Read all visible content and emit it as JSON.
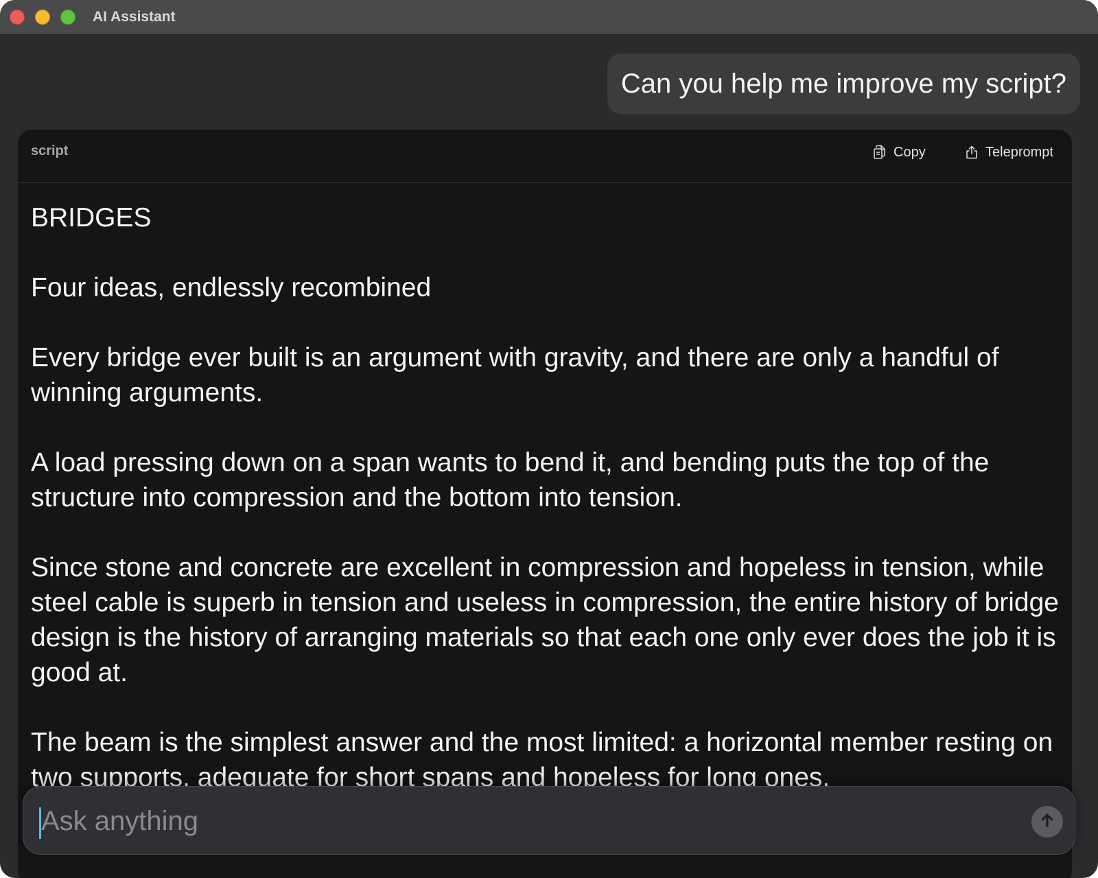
{
  "window": {
    "title": "AI Assistant"
  },
  "conversation": {
    "user_message": "Can you help me improve my script?"
  },
  "script_card": {
    "label": "script",
    "copy_label": "Copy",
    "teleprompt_label": "Teleprompt",
    "paragraphs": [
      "BRIDGES",
      "Four ideas, endlessly recombined",
      "Every bridge ever built is an argument with gravity, and there are only a handful of winning arguments.",
      "A load pressing down on a span wants to bend it, and bending puts the top of the structure into compression and the bottom into tension.",
      "Since stone and concrete are excellent in compression and hopeless in tension, while steel cable is superb in tension and useless in compression, the entire history of bridge design is the history of arranging materials so that each one only ever does the job it is good at.",
      "The beam is the simplest answer and the most limited: a horizontal member resting on two supports, adequate for short spans and hopeless for long ones."
    ]
  },
  "composer": {
    "placeholder": "Ask anything",
    "value": ""
  },
  "icons": {
    "copy": "copy-icon",
    "teleprompt": "share-icon",
    "send": "arrow-up-icon"
  },
  "colors": {
    "window_bg": "#2b2b2d",
    "titlebar_bg": "#4a4a4d",
    "card_bg": "#151516",
    "bubble_bg": "#3c3c3f",
    "caret": "#4fc3d9"
  }
}
